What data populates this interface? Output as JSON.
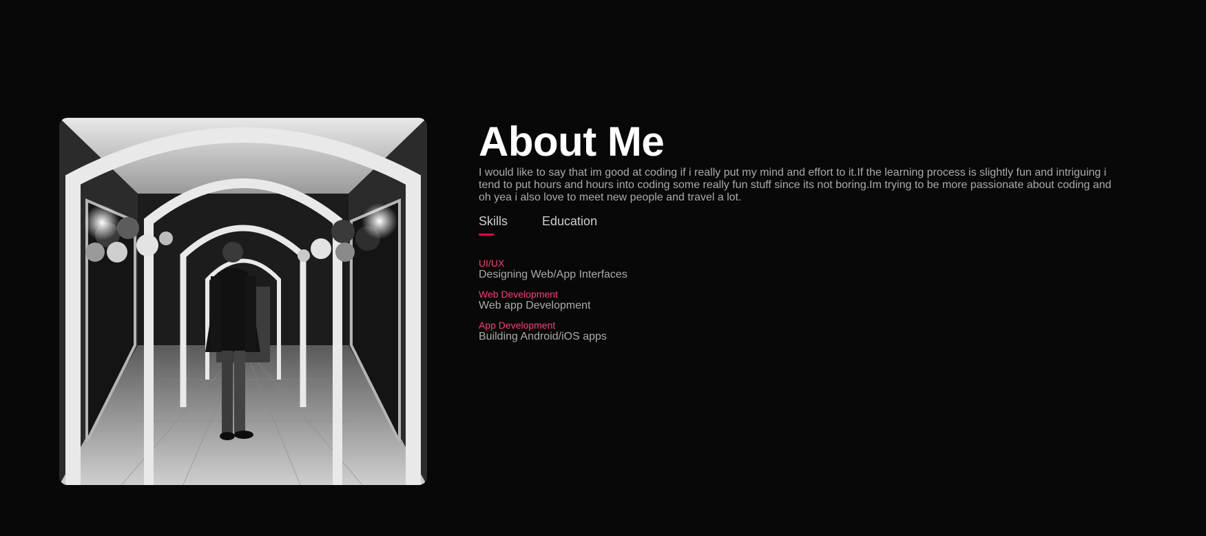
{
  "about": {
    "title": "About Me",
    "description": "I would like to say that im good at coding if i really put my mind and effort to it.If the learning process is slightly fun and intriguing i tend to put hours and hours into coding some really fun stuff since its not boring.Im trying to be more passionate about coding and oh yea i also love to meet new people and travel a lot."
  },
  "tabs": [
    {
      "label": "Skills",
      "active": true
    },
    {
      "label": "Education",
      "active": false
    }
  ],
  "skills": [
    {
      "name": "UI/UX",
      "description": "Designing Web/App Interfaces"
    },
    {
      "name": "Web Development",
      "description": "Web app Development"
    },
    {
      "name": "App Development",
      "description": "Building Android/iOS apps"
    }
  ],
  "colors": {
    "background": "#080808",
    "accent": "#ff004f",
    "skill_name": "#ff3d75",
    "text": "#ababab",
    "title": "#ffffff"
  }
}
